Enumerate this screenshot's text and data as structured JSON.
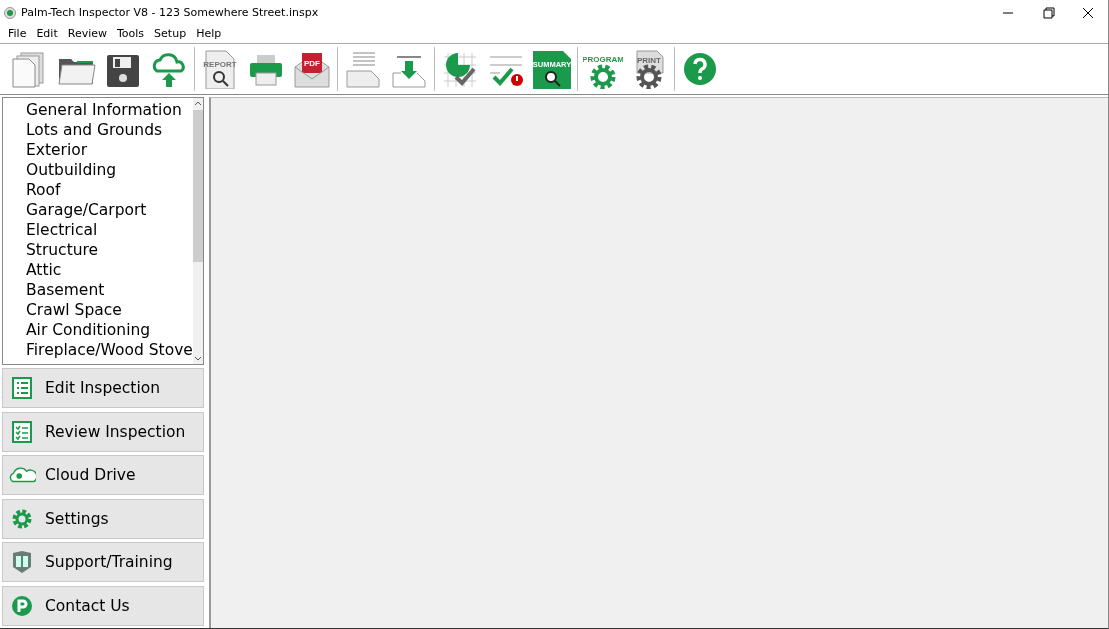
{
  "window": {
    "title": "Palm-Tech Inspector V8 - 123 Somewhere Street.inspx"
  },
  "menu": [
    "File",
    "Edit",
    "Review",
    "Tools",
    "Setup",
    "Help"
  ],
  "toolbar": [
    [
      {
        "kind": "new"
      },
      {
        "kind": "open"
      },
      {
        "kind": "save"
      },
      {
        "kind": "cloud-upload"
      }
    ],
    [
      {
        "kind": "report",
        "text": "REPORT"
      },
      {
        "kind": "print"
      },
      {
        "kind": "pdf",
        "text": "PDF"
      }
    ],
    [
      {
        "kind": "lines"
      },
      {
        "kind": "import"
      }
    ],
    [
      {
        "kind": "chart"
      },
      {
        "kind": "checklist"
      },
      {
        "kind": "summary",
        "text": "SUMMARY"
      }
    ],
    [
      {
        "kind": "gear",
        "text": "PROGRAM"
      },
      {
        "kind": "gear-doc",
        "text": "PRINT"
      }
    ],
    [
      {
        "kind": "help"
      }
    ]
  ],
  "sections": [
    "General Information",
    "Lots and Grounds",
    "Exterior",
    "Outbuilding",
    "Roof",
    "Garage/Carport",
    "Electrical",
    "Structure",
    "Attic",
    "Basement",
    "Crawl Space",
    "Air Conditioning",
    "Fireplace/Wood Stove"
  ],
  "nav": [
    {
      "kind": "list",
      "label": "Edit Inspection"
    },
    {
      "kind": "checklist",
      "label": "Review Inspection"
    },
    {
      "kind": "cloud",
      "label": "Cloud Drive"
    },
    {
      "kind": "gear",
      "label": "Settings"
    },
    {
      "kind": "book",
      "label": "Support/Training"
    },
    {
      "kind": "logo",
      "label": "Contact Us"
    }
  ]
}
